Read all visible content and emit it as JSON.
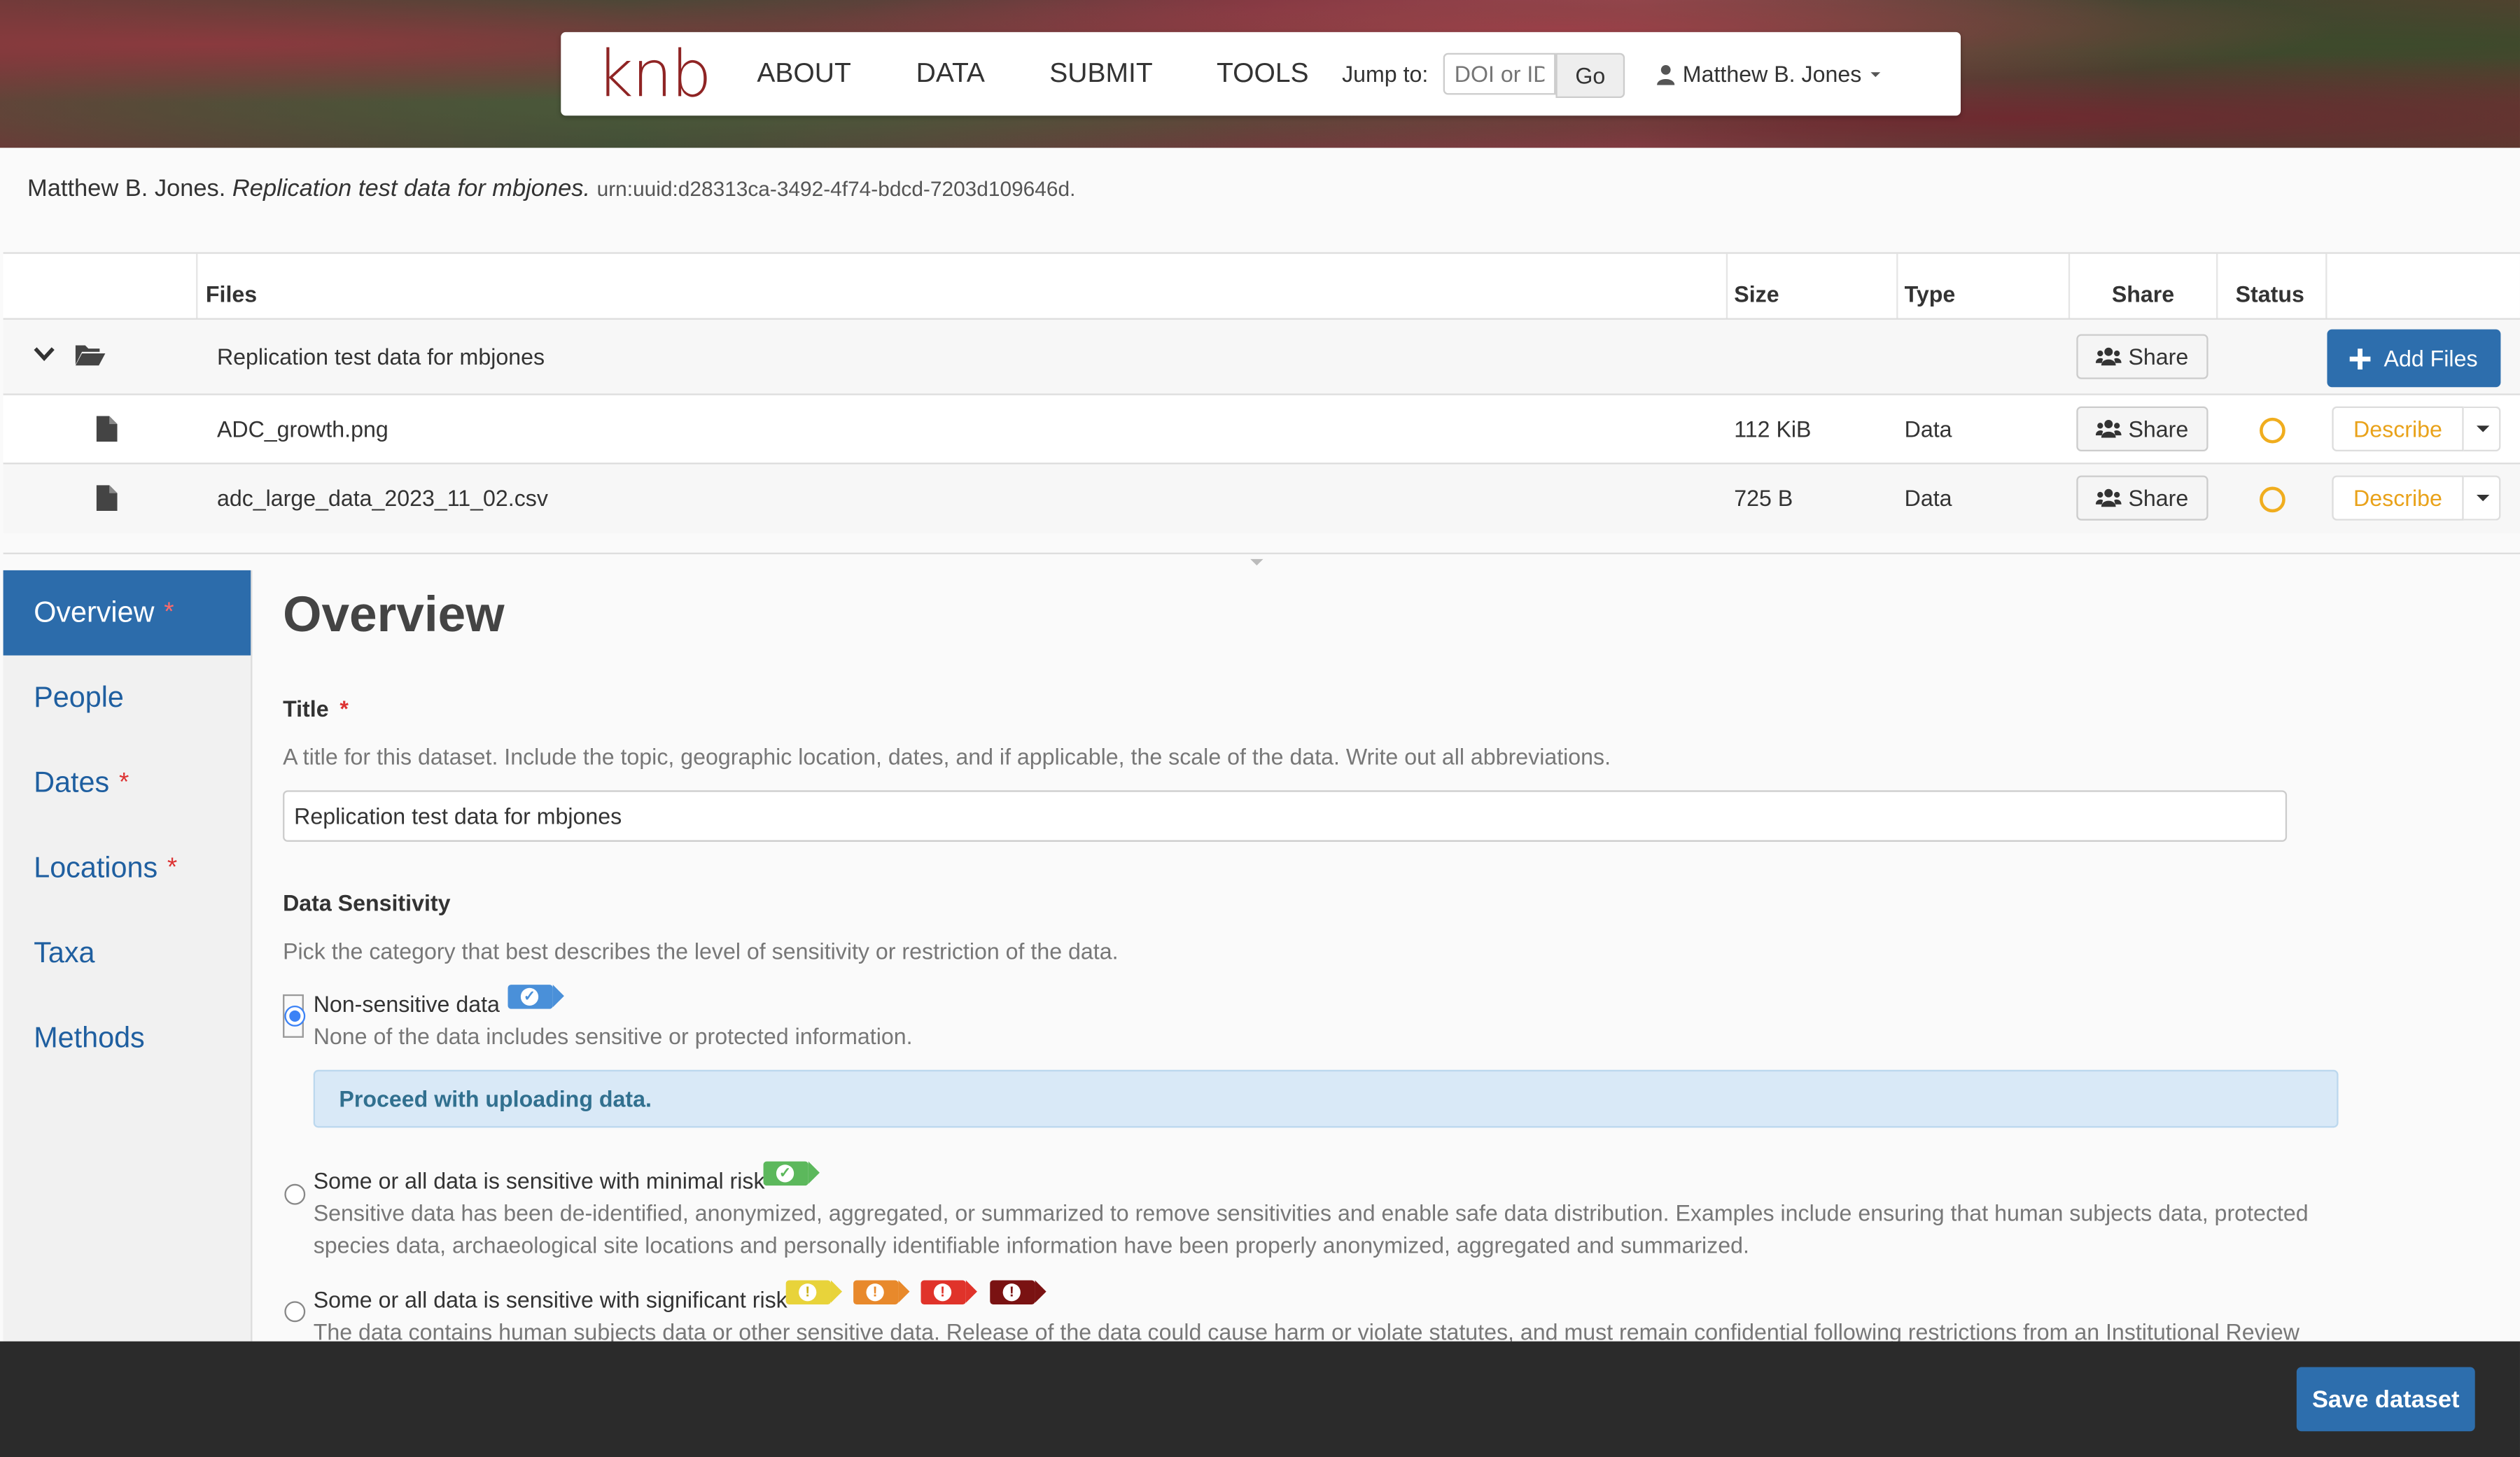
{
  "header": {
    "logo_text": "knb",
    "nav": [
      "ABOUT",
      "DATA",
      "SUBMIT",
      "TOOLS"
    ],
    "jump_label": "Jump to:",
    "jump_placeholder": "DOI or ID",
    "go_label": "Go",
    "user_name": "Matthew B. Jones"
  },
  "citation": {
    "author": "Matthew B. Jones.",
    "title": "Replication test data for mbjones.",
    "urn": "urn:uuid:d28313ca-3492-4f74-bdcd-7203d109646d."
  },
  "files_table": {
    "columns": {
      "files": "Files",
      "size": "Size",
      "type": "Type",
      "share": "Share",
      "status": "Status"
    },
    "package": {
      "name": "Replication test data for mbjones",
      "share_label": "Share",
      "add_files_label": "Add Files"
    },
    "rows": [
      {
        "name": "ADC_growth.png",
        "size": "112 KiB",
        "type": "Data",
        "share_label": "Share",
        "describe_label": "Describe"
      },
      {
        "name": "adc_large_data_2023_11_02.csv",
        "size": "725 B",
        "type": "Data",
        "share_label": "Share",
        "describe_label": "Describe"
      }
    ]
  },
  "sidebar": {
    "items": [
      {
        "label": "Overview",
        "required": "*"
      },
      {
        "label": "People",
        "required": ""
      },
      {
        "label": "Dates",
        "required": "*"
      },
      {
        "label": "Locations",
        "required": "*"
      },
      {
        "label": "Taxa",
        "required": ""
      },
      {
        "label": "Methods",
        "required": ""
      }
    ]
  },
  "overview": {
    "heading": "Overview",
    "title_label": "Title",
    "title_required": "*",
    "title_help": "A title for this dataset. Include the topic, geographic location, dates, and if applicable, the scale of the data. Write out all abbreviations.",
    "title_value": "Replication test data for mbjones",
    "sensitivity_label": "Data Sensitivity",
    "sensitivity_help": "Pick the category that best describes the level of sensitivity or restriction of the data.",
    "options": [
      {
        "title": "Non-sensitive data",
        "desc": "None of the data includes sensitive or protected information."
      },
      {
        "title": "Some or all data is sensitive with minimal risk",
        "desc": "Sensitive data has been de-identified, anonymized, aggregated, or summarized to remove sensitivities and enable safe data distribution. Examples include ensuring that human subjects data, protected species data, archaeological site locations and personally identifiable information have been properly anonymized, aggregated and summarized."
      },
      {
        "title": "Some or all data is sensitive with significant risk",
        "desc": "The data contains human subjects data or other sensitive data. Release of the data could cause harm or violate statutes, and must remain confidential following restrictions from an Institutional Review Board"
      }
    ],
    "proceed_message": "Proceed with uploading data."
  },
  "footer": {
    "save_label": "Save dataset"
  },
  "colors": {
    "brand": "#8f2424",
    "primary": "#2d6ead",
    "warning": "#f0ad1e",
    "tag_blue": "#4a90d9",
    "tag_green": "#5cb85c",
    "tag_yellow": "#e8d33a",
    "tag_orange": "#e8892b",
    "tag_red": "#e0332a",
    "tag_darkred": "#7a1212"
  }
}
